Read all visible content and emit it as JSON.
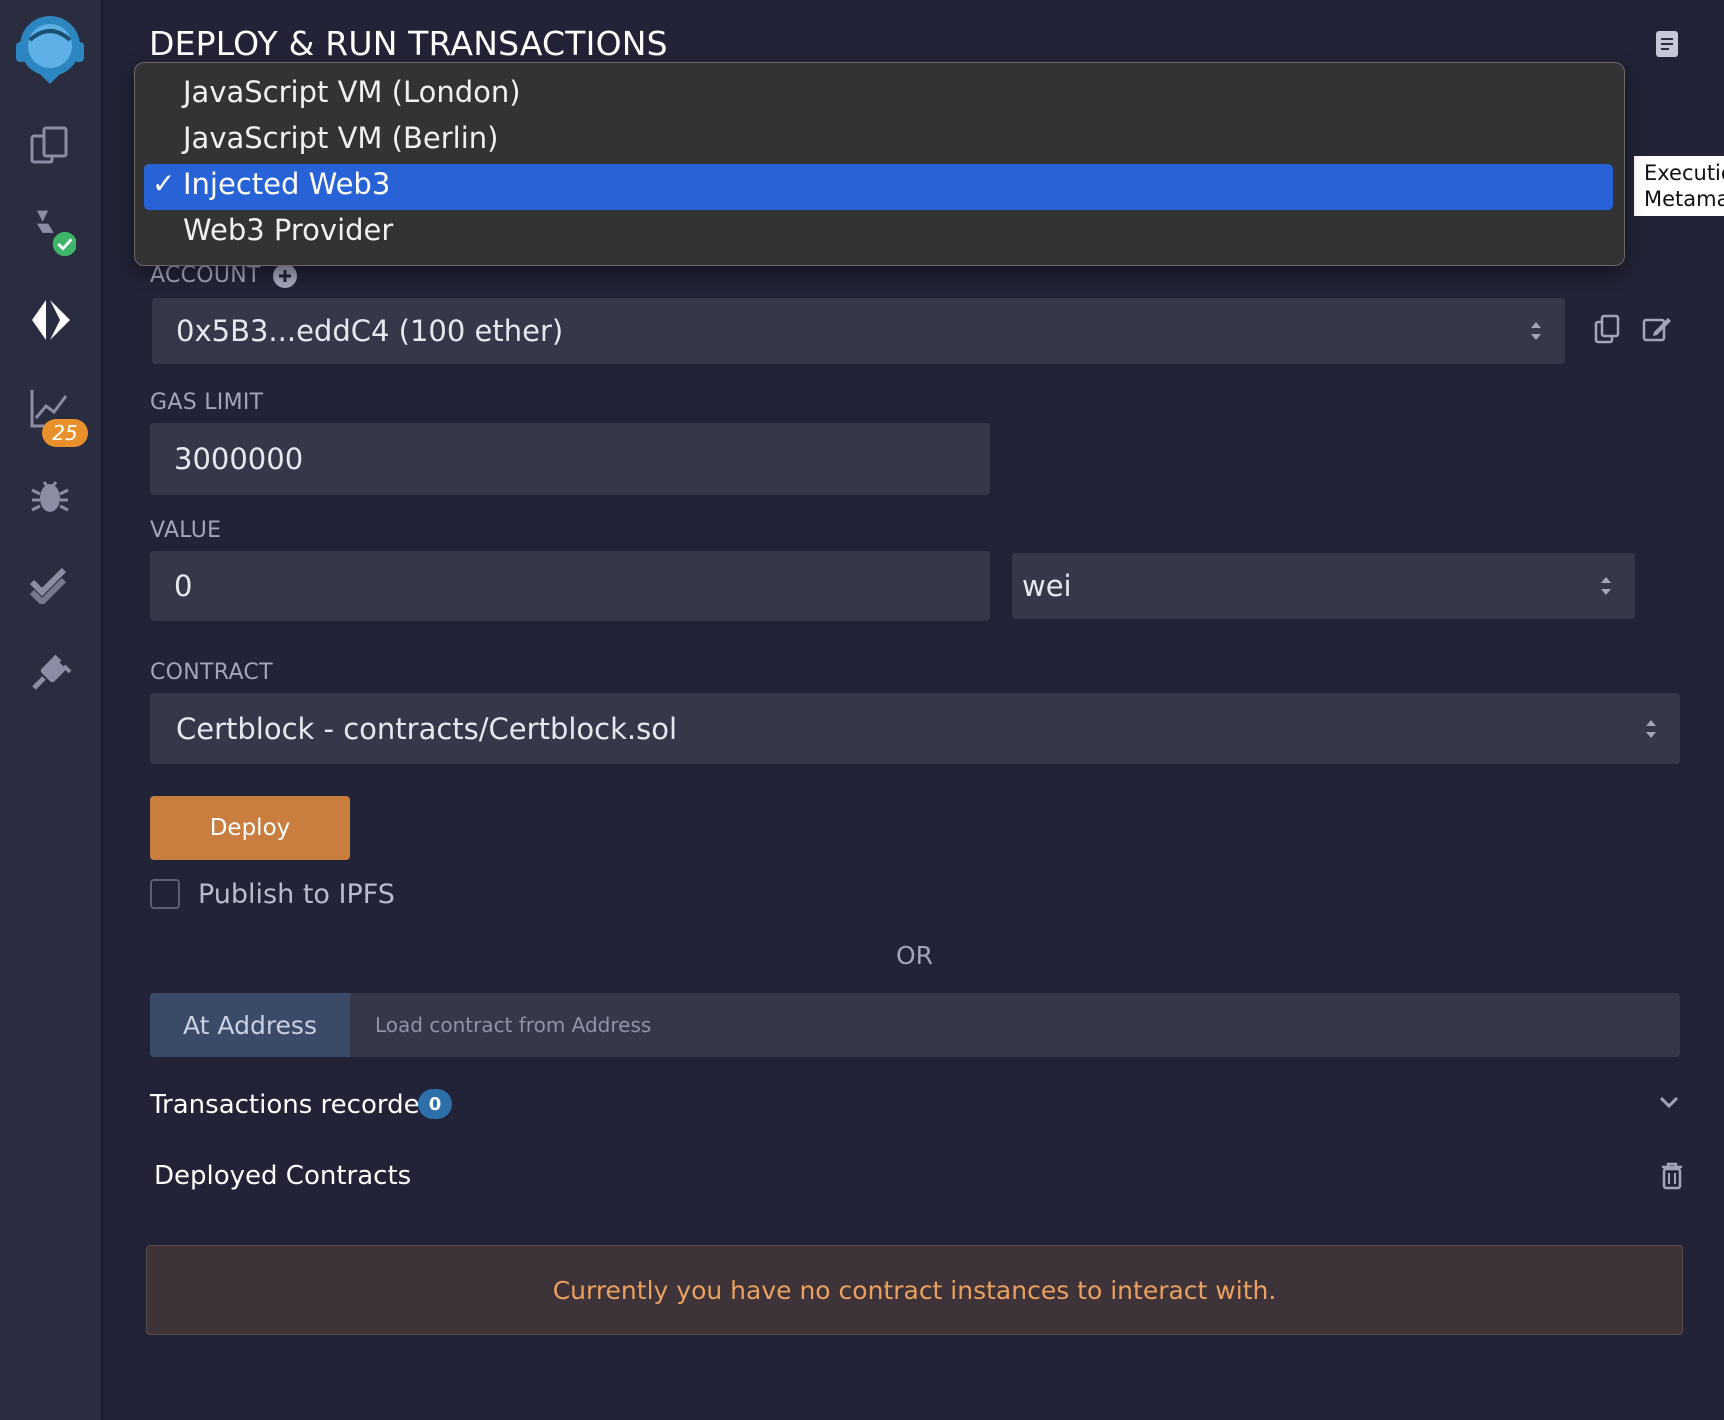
{
  "panel": {
    "title": "DEPLOY & RUN TRANSACTIONS"
  },
  "environment_dropdown": {
    "options": [
      "JavaScript VM (London)",
      "JavaScript VM (Berlin)",
      "Injected Web3",
      "Web3 Provider"
    ],
    "selected": "Injected Web3",
    "check_mark": "✓"
  },
  "tooltip": {
    "line1": "Executio",
    "line2": "Metama"
  },
  "account": {
    "label": "ACCOUNT",
    "value": "0x5B3...eddC4 (100 ether)"
  },
  "gas_limit": {
    "label": "GAS LIMIT",
    "value": "3000000"
  },
  "value": {
    "label": "VALUE",
    "amount": "0",
    "unit": "wei"
  },
  "contract": {
    "label": "CONTRACT",
    "selected": "Certblock - contracts/Certblock.sol"
  },
  "deploy": {
    "button_label": "Deploy",
    "publish_label": "Publish to IPFS",
    "publish_checked": false
  },
  "or_text": "OR",
  "at_address": {
    "button_label": "At Address",
    "placeholder": "Load contract from Address"
  },
  "transactions": {
    "label": "Transactions recorded",
    "count": "0"
  },
  "deployed_contracts": {
    "label": "Deployed Contracts",
    "empty_message": "Currently you have no contract instances to interact with."
  },
  "sidebar": {
    "items": [
      {
        "icon": "remix-logo-icon"
      },
      {
        "icon": "file-explorer-icon"
      },
      {
        "icon": "solidity-compiler-icon"
      },
      {
        "icon": "deploy-run-icon"
      },
      {
        "icon": "analysis-icon",
        "badge": "25"
      },
      {
        "icon": "debugger-icon"
      },
      {
        "icon": "unit-testing-icon"
      },
      {
        "icon": "plugin-manager-icon"
      }
    ]
  },
  "colors": {
    "background": "#222336",
    "accent_blue": "#2763d6",
    "deploy_orange": "#c97e40",
    "badge_orange": "#e8912c",
    "success_green": "#3fb56a"
  }
}
